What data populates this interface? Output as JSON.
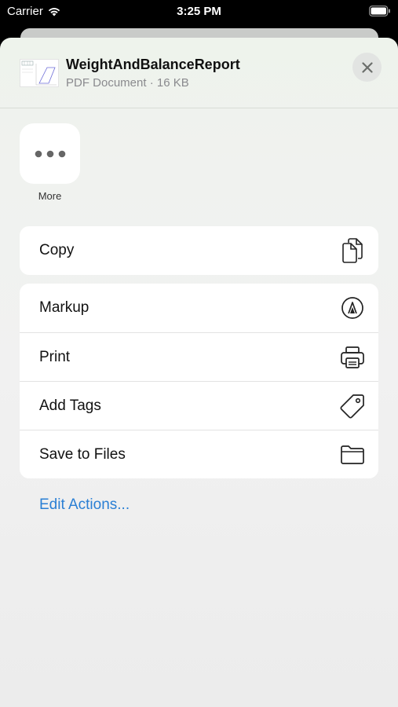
{
  "status": {
    "carrier": "Carrier",
    "time": "3:25 PM"
  },
  "file": {
    "title": "WeightAndBalanceReport",
    "subtitle": "PDF Document · 16 KB"
  },
  "more": {
    "label": "More"
  },
  "copy_group": [
    {
      "label": "Copy",
      "icon": "copy-icon"
    }
  ],
  "actions": [
    {
      "label": "Markup",
      "icon": "markup-icon"
    },
    {
      "label": "Print",
      "icon": "printer-icon"
    },
    {
      "label": "Add Tags",
      "icon": "tag-icon"
    },
    {
      "label": "Save to Files",
      "icon": "folder-icon"
    }
  ],
  "edit_actions": "Edit Actions...",
  "colors": {
    "accent": "#2a7fd4",
    "background": "#f0f1ef"
  }
}
